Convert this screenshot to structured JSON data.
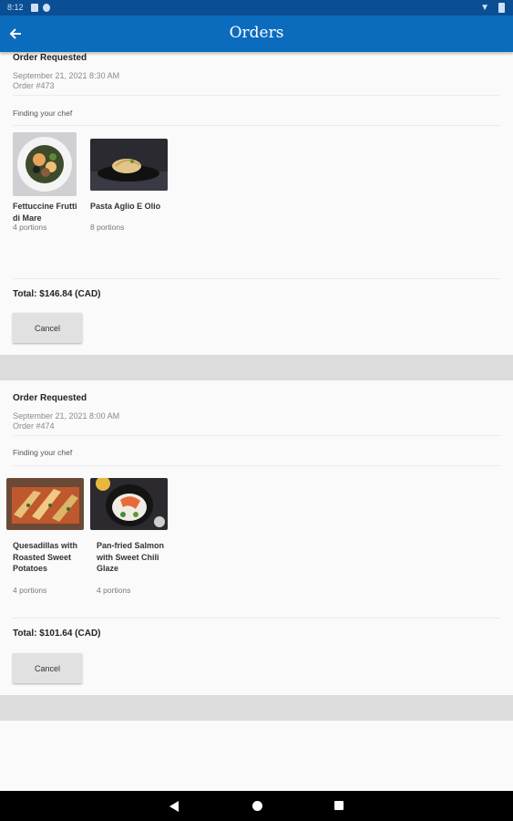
{
  "status_bar": {
    "time": "8:12"
  },
  "app_bar": {
    "back_icon": "arrow-left-icon",
    "title": "Orders"
  },
  "orders": [
    {
      "status": "Order Requested",
      "date": "September 21, 2021 8:30 AM",
      "number": "Order #473",
      "chef_status": "Finding your chef",
      "dishes": [
        {
          "name": "Fettuccine Frutti di Mare",
          "portions": "4 portions"
        },
        {
          "name": "Pasta Aglio E Olio",
          "portions": "8 portions"
        }
      ],
      "total": "Total: $146.84 (CAD)",
      "cancel_label": "Cancel"
    },
    {
      "status": "Order Requested",
      "date": "September 21, 2021 8:00 AM",
      "number": "Order #474",
      "chef_status": "Finding your chef",
      "dishes": [
        {
          "name": "Quesadillas with Roasted Sweet Potatoes",
          "portions": "4 portions"
        },
        {
          "name": "Pan-fried Salmon with Sweet Chili Glaze",
          "portions": "4 portions"
        }
      ],
      "total": "Total: $101.64 (CAD)",
      "cancel_label": "Cancel"
    }
  ],
  "colors": {
    "app_bar": "#0b6cbe",
    "status_bar": "#0a4f94",
    "separator_band": "#dcdcdc"
  },
  "nav_bar": {
    "icons": [
      "back-triangle-icon",
      "home-circle-icon",
      "recents-square-icon"
    ]
  }
}
